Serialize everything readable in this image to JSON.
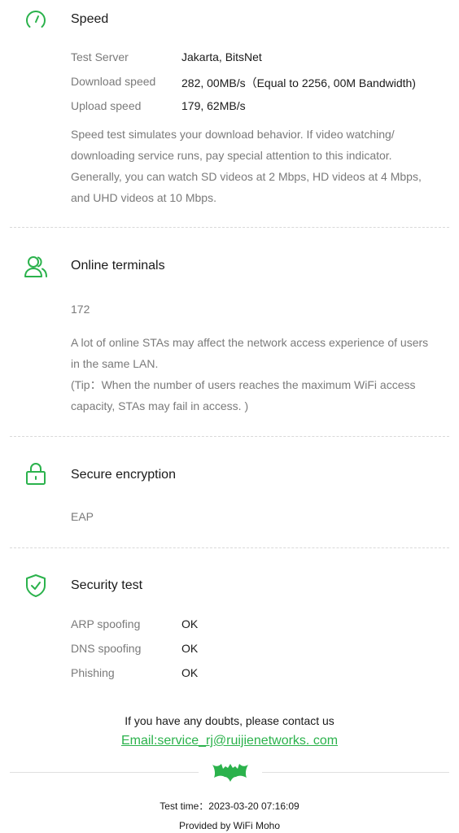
{
  "colors": {
    "accent": "#2bb24c",
    "muted": "#7a7a7a",
    "text": "#1a1a1a"
  },
  "speed": {
    "icon": "speedometer-icon",
    "title": "Speed",
    "rows": [
      {
        "label": "Test Server",
        "value": "Jakarta, BitsNet"
      },
      {
        "label": "Download speed",
        "value": "282, 00MB/s（Equal to 2256, 00M Bandwidth)"
      },
      {
        "label": "Upload speed",
        "value": "179, 62MB/s"
      }
    ],
    "description": "Speed test simulates your download behavior.  If video watching/ downloading service runs,  pay special attention to this indicator.  Generally,  you can watch SD videos at 2 Mbps,  HD videos at 4 Mbps,  and UHD videos at 10 Mbps."
  },
  "terminals": {
    "icon": "users-icon",
    "title": "Online terminals",
    "count": "172",
    "description1": "A lot of online STAs may affect the network access experience of users in the same LAN.",
    "description2": "(Tip：When the number of users reaches the maximum WiFi access capacity,  STAs may fail in access. )"
  },
  "encryption": {
    "icon": "lock-icon",
    "title": "Secure encryption",
    "value": "EAP"
  },
  "security": {
    "icon": "shield-check-icon",
    "title": "Security test",
    "rows": [
      {
        "label": "ARP spoofing",
        "value": "OK"
      },
      {
        "label": "DNS spoofing",
        "value": "OK"
      },
      {
        "label": "Phishing",
        "value": "OK"
      }
    ]
  },
  "footer": {
    "contact": "If you have any doubts,  please contact us",
    "email": "Email:service_rj@ruijienetworks. com",
    "logo": "bat-logo-icon",
    "test_time": "Test time：2023-03-20 07:16:09",
    "provided_by": "Provided by WiFi Moho"
  }
}
